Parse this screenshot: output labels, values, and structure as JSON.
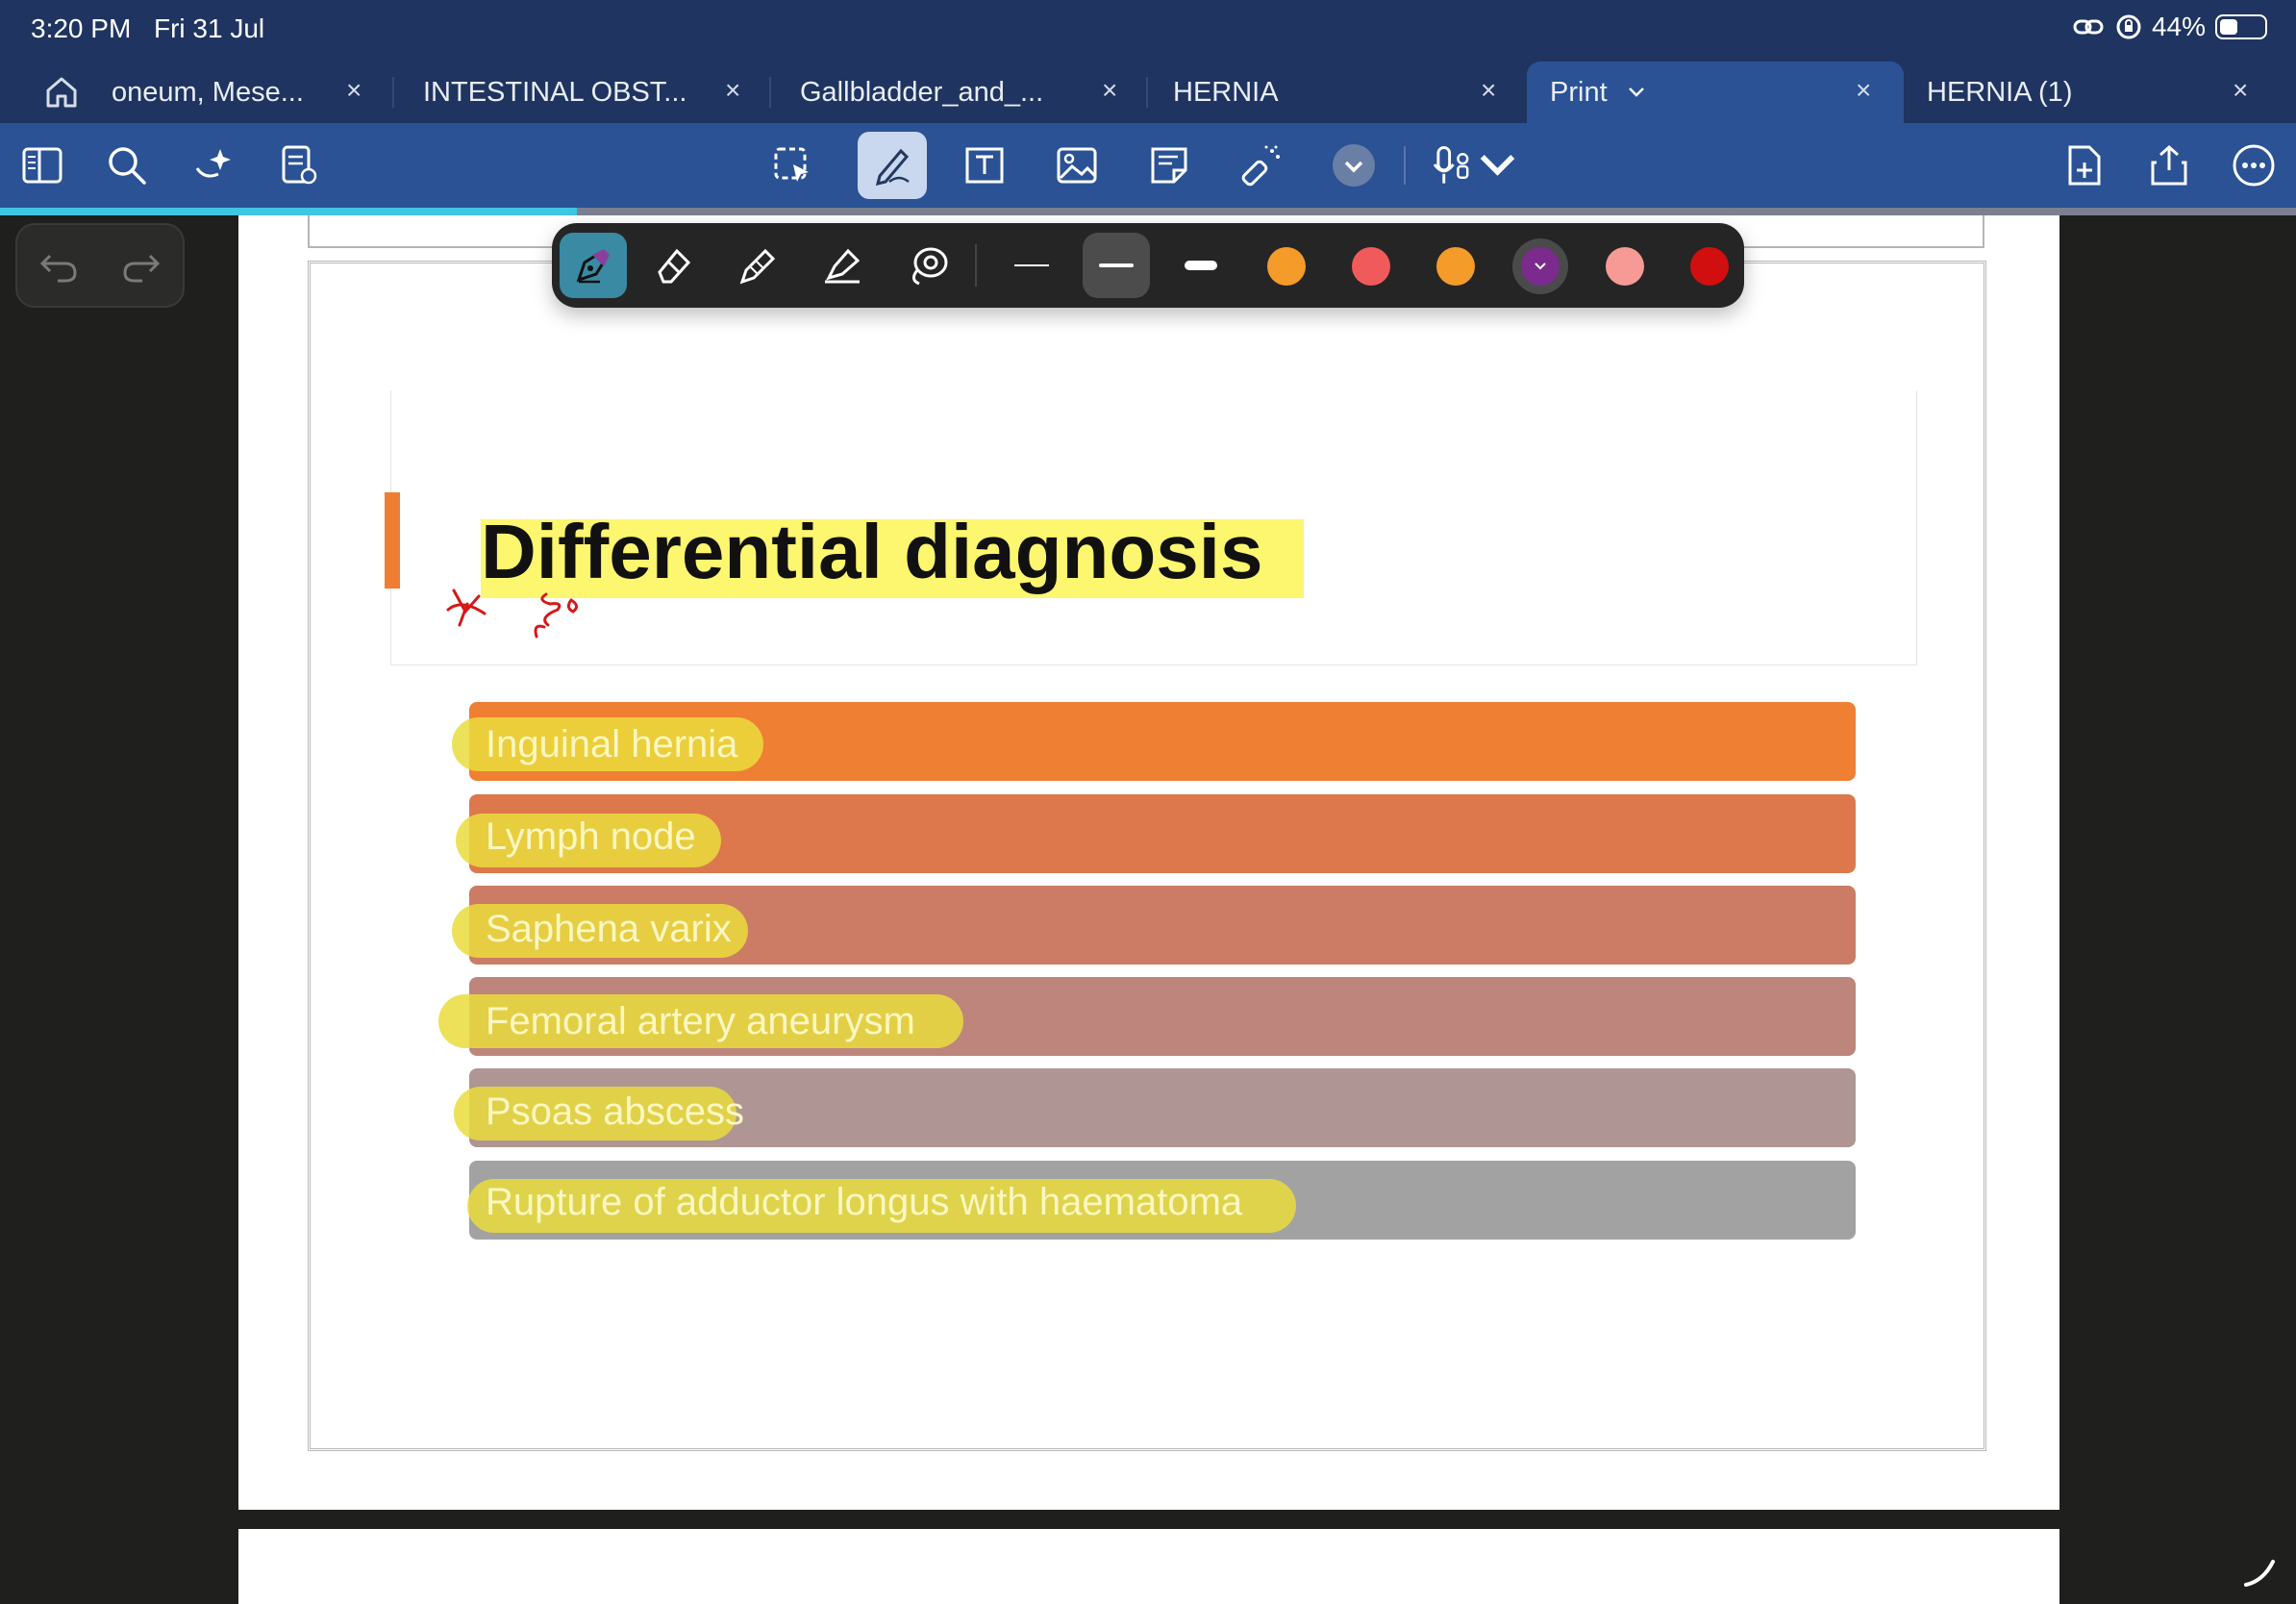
{
  "status": {
    "time": "3:20 PM",
    "date": "Fri 31 Jul",
    "battery": "44%"
  },
  "tabs": [
    {
      "label": "oneum, Mese...",
      "active": false
    },
    {
      "label": "INTESTINAL OBST...",
      "active": false
    },
    {
      "label": "Gallbladder_and_...",
      "active": false
    },
    {
      "label": "HERNIA",
      "active": false
    },
    {
      "label": "Print",
      "active": true
    },
    {
      "label": "HERNIA (1)",
      "active": false
    }
  ],
  "tab_close_glyph": "×",
  "document": {
    "title": "Differential diagnosis",
    "items": [
      {
        "label": "Inguinal hernia",
        "color": "#ef7f33"
      },
      {
        "label": "Lymph node",
        "color": "#dc784c"
      },
      {
        "label": "Saphena varix",
        "color": "#cc7b64"
      },
      {
        "label": "Femoral artery aneurysm",
        "color": "#bd857c"
      },
      {
        "label": "Psoas abscess",
        "color": "#af9593"
      },
      {
        "label": "Rupture of adductor longus with haematoma",
        "color": "#a2a2a2"
      }
    ]
  },
  "palette": {
    "tools": [
      "fountain-pen-tool",
      "eraser-tool",
      "pencil-tool",
      "highlighter-tool",
      "lasso-tool"
    ],
    "stroke_widths": [
      "thin",
      "medium",
      "thick"
    ],
    "colors": [
      "#f59b2a",
      "#f15a5a",
      "#f59b2a",
      "#7b2a8e",
      "#f79a95",
      "#d10f0f"
    ]
  },
  "colors": {
    "status_bar": "#1f3460",
    "toolbar": "#2a5295",
    "accent": "#3fc6e2",
    "highlight": "#fdf66f"
  }
}
